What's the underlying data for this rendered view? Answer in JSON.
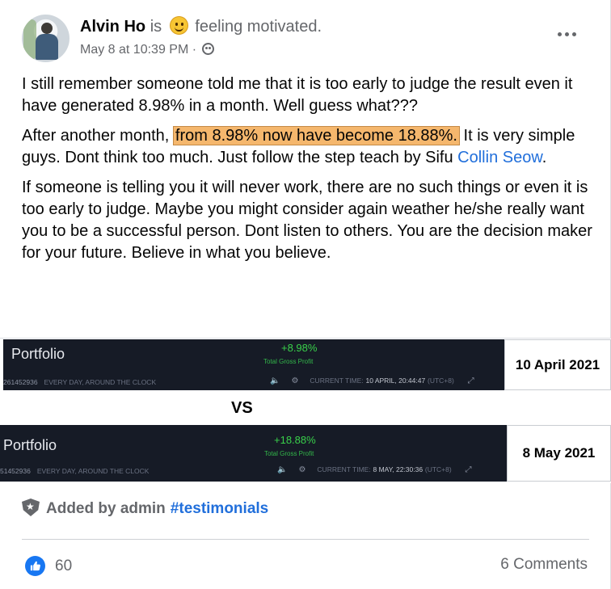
{
  "post": {
    "author": "Alvin Ho",
    "is_word": "is",
    "feeling": "feeling motivated.",
    "timestamp": "May 8 at 10:39 PM ·",
    "paragraphs": {
      "p1": "I still remember someone told me that it is too early to judge the result even it have generated 8.98% in a month. Well guess what???",
      "p2_before": "After another month, ",
      "p2_highlight": "from 8.98% now have become 18.88%.",
      "p2_after": " It is very simple guys. Dont think too much. Just follow the step teach by Sifu ",
      "p2_link": "Collin Seow",
      "p2_end": ".",
      "p3": "If someone is telling you it will never work, there are no such things or even it is too early to judge. Maybe you might consider again weather he/she really want you to be a successful person. Dont listen to others. You are the decision maker for your future. Believe in what you believe."
    }
  },
  "image": {
    "vs_label": "VS",
    "dash1": {
      "title": "Portfolio",
      "profit": "+8.98%",
      "profit_label": "Total Gross Profit",
      "account": "261452936",
      "account_tag": "EVERY DAY, AROUND THE CLOCK",
      "time_label": "CURRENT TIME:",
      "time_value": "10 APRIL, 20:44:47",
      "tz": "(UTC+8)",
      "date": "10 April 2021"
    },
    "dash2": {
      "title": "Portfolio",
      "profit": "+18.88%",
      "profit_label": "Total Gross Profit",
      "account": "51452936",
      "account_tag": "EVERY DAY, AROUND THE CLOCK",
      "time_label": "CURRENT TIME:",
      "time_value": "8 MAY, 22:30:36",
      "tz": "(UTC+8)",
      "date": "8 May 2021"
    }
  },
  "footer": {
    "added_by": "Added by admin",
    "hashtag": "#testimonials",
    "like_count": "60",
    "comments": "6 Comments"
  },
  "colors": {
    "highlight": "#f5b76d",
    "link": "#216fdb",
    "like_blue": "#1877f2",
    "profit_green": "#39d14a"
  },
  "icons": [
    "smiley-icon",
    "audience-icon",
    "more-icon",
    "speaker-icon",
    "gear-icon",
    "fullscreen-icon",
    "shield-icon",
    "like-icon"
  ]
}
